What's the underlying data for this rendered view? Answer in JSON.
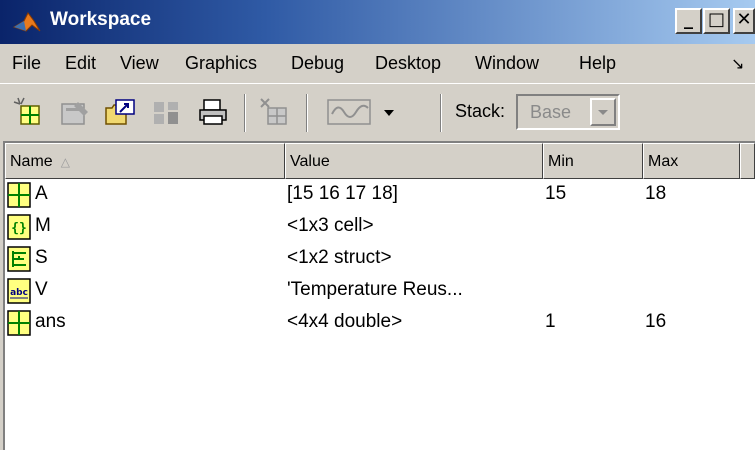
{
  "window": {
    "title": "Workspace",
    "controls": {
      "minimize": "_",
      "maximize": "□",
      "close": "✕"
    }
  },
  "menu": {
    "items": [
      "File",
      "Edit",
      "View",
      "Graphics",
      "Debug",
      "Desktop",
      "Window",
      "Help"
    ],
    "overflow": "↘"
  },
  "toolbar": {
    "buttons": [
      "new-variable-icon",
      "open-variable-icon",
      "import-data-icon",
      "save-icon",
      "print-icon",
      "delete-icon",
      "plot-icon",
      "plot-dropdown-icon"
    ],
    "stack_label": "Stack:",
    "stack_value": "Base"
  },
  "table": {
    "headers": [
      "Name",
      "Value",
      "Min",
      "Max"
    ],
    "sorted_by": "Name",
    "rows": [
      {
        "icon": "matrix-icon",
        "name": "A",
        "value": "[15 16 17 18]",
        "min": "15",
        "max": "18"
      },
      {
        "icon": "cell-array-icon",
        "name": "M",
        "value": "<1x3 cell>",
        "min": "",
        "max": ""
      },
      {
        "icon": "struct-icon",
        "name": "S",
        "value": "<1x2 struct>",
        "min": "",
        "max": ""
      },
      {
        "icon": "char-icon",
        "name": "V",
        "value": "'Temperature Reus...",
        "min": "",
        "max": ""
      },
      {
        "icon": "matrix-icon",
        "name": "ans",
        "value": "<4x4 double>",
        "min": "1",
        "max": "16"
      }
    ]
  },
  "colors": {
    "title_gradient_start": "#0a246a",
    "title_gradient_end": "#a6caf0",
    "chrome": "#d4d0c8",
    "icon_yellow": "#ffff80",
    "icon_green": "#008000"
  }
}
